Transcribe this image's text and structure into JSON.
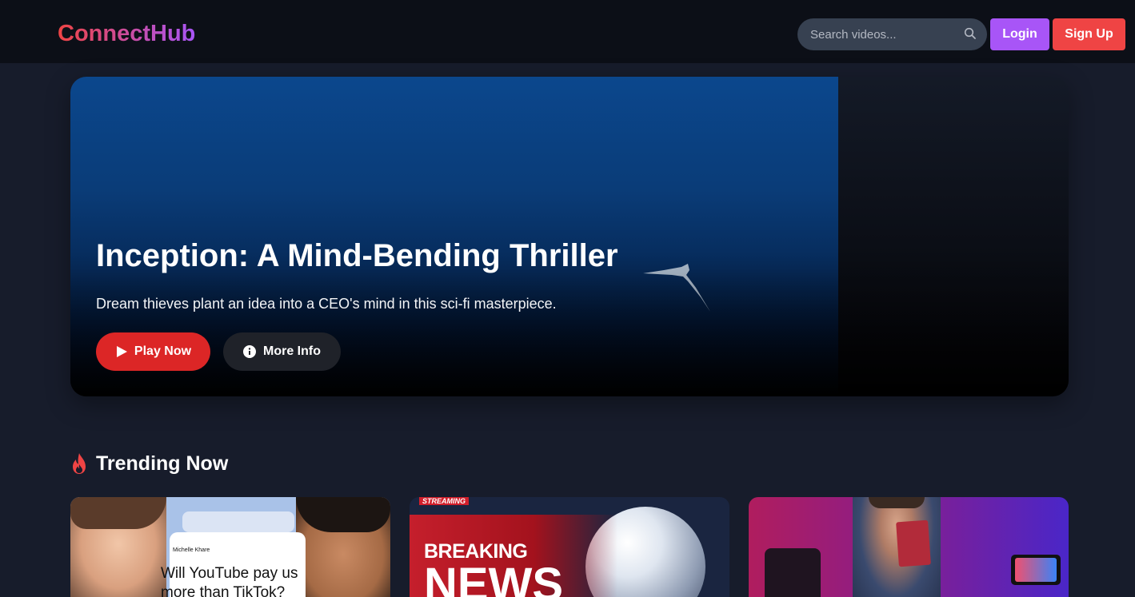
{
  "brand": {
    "name": "ConnectHub"
  },
  "search": {
    "placeholder": "Search videos..."
  },
  "auth": {
    "login_label": "Login",
    "signup_label": "Sign Up"
  },
  "hero": {
    "title": "Inception: A Mind-Bending Thriller",
    "description": "Dream thieves plant an idea into a CEO's mind in this sci-fi masterpiece.",
    "play_label": "Play Now",
    "info_label": "More Info"
  },
  "trending": {
    "title": "Trending Now",
    "cards": [
      {
        "tweet_user": "Michelle Khare",
        "tweet_text": "Will YouTube pay us more than TikTok?"
      },
      {
        "tag": "STREAMING",
        "headline_top": "BREAKING",
        "headline_bottom": "NEWS"
      },
      {}
    ]
  },
  "colors": {
    "accent_purple": "#a855f7",
    "accent_red": "#ef4444",
    "play_red": "#dc2626",
    "header_bg": "#0c0f17",
    "page_bg": "#171c2b"
  },
  "icons": {
    "search": "search-icon",
    "play": "play-icon",
    "info": "info-icon",
    "trending": "fire-icon"
  }
}
